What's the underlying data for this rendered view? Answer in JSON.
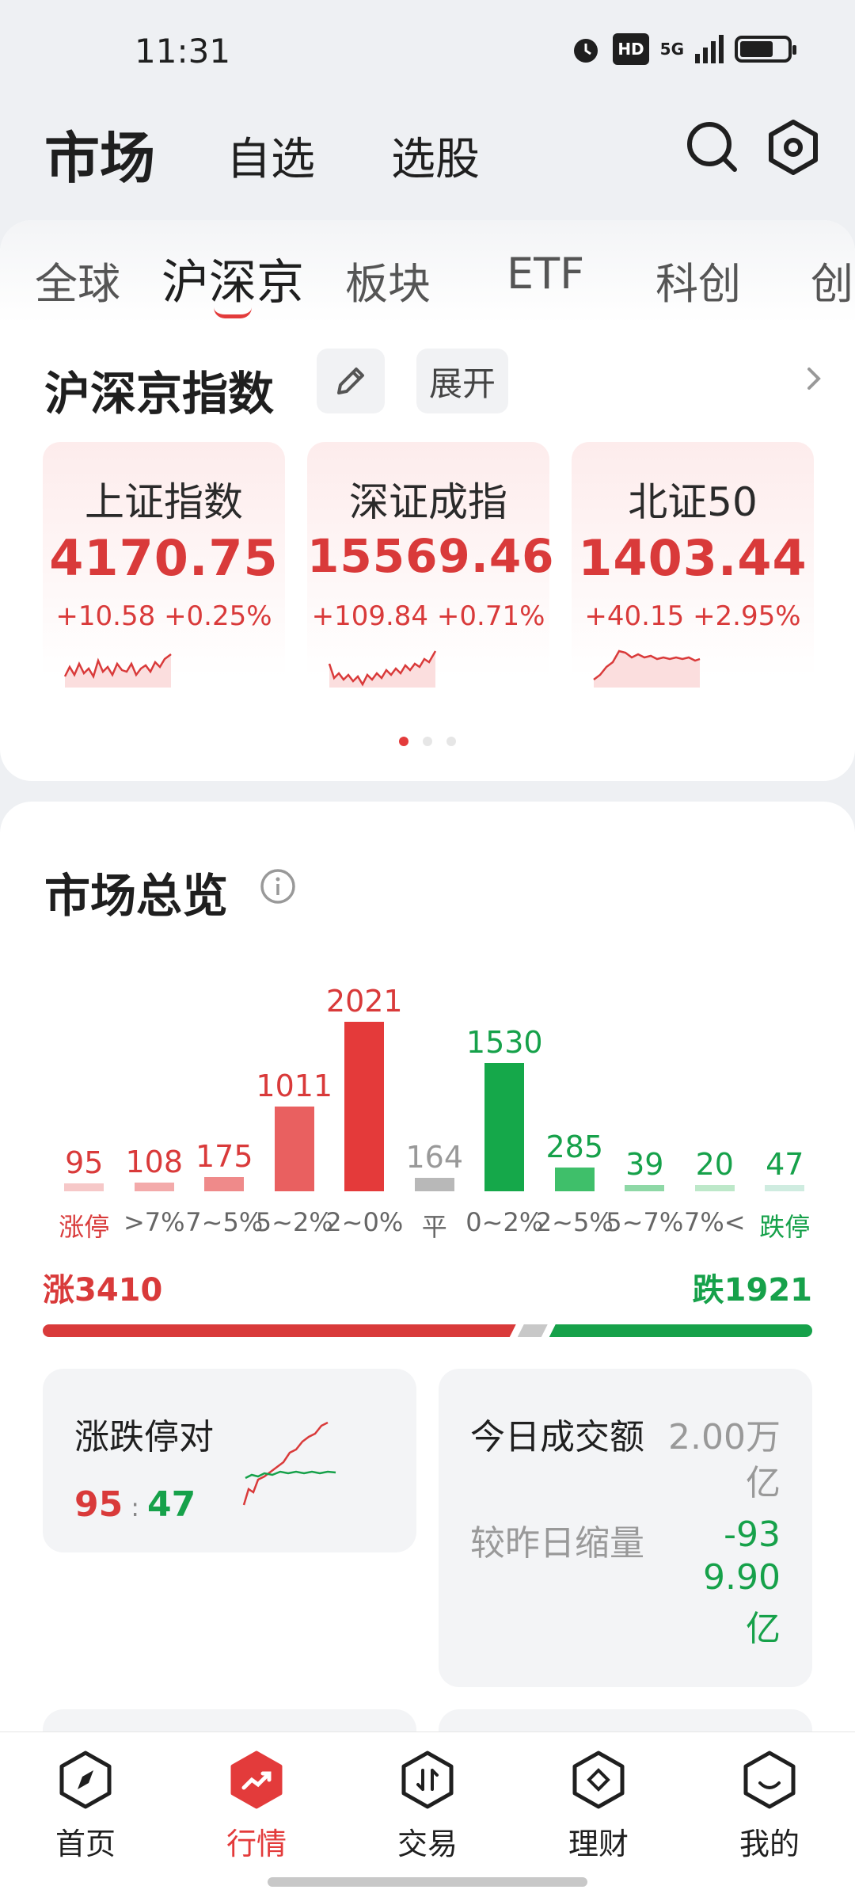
{
  "status_bar": {
    "time": "11:31",
    "hd": "HD",
    "network": "5G",
    "battery_level": 0.7
  },
  "header": {
    "tabs": [
      {
        "label": "市场",
        "active": true
      },
      {
        "label": "自选",
        "active": false
      },
      {
        "label": "选股",
        "active": false
      }
    ],
    "icons": [
      "search-icon",
      "settings-icon"
    ]
  },
  "subtabs": {
    "items": [
      {
        "label": "全球",
        "active": false
      },
      {
        "label": "沪深京",
        "active": true
      },
      {
        "label": "板块",
        "active": false
      },
      {
        "label": "ETF",
        "active": false
      },
      {
        "label": "科创",
        "active": false
      },
      {
        "label": "创",
        "active": false
      }
    ]
  },
  "indices_section": {
    "title": "沪深京指数",
    "expand_label": "展开",
    "cards": [
      {
        "name": "上证指数",
        "value": "4170.75",
        "change": "+10.58",
        "percent": "+0.25%"
      },
      {
        "name": "深证成指",
        "value": "15569.46",
        "change": "+109.84",
        "percent": "+0.71%"
      },
      {
        "name": "北证50",
        "value": "1403.44",
        "change": "+40.15",
        "percent": "+2.95%"
      }
    ],
    "page_count": 3,
    "active_page": 1
  },
  "overview": {
    "title": "市场总览",
    "chart_data": {
      "type": "bar",
      "categories": [
        "涨停",
        ">7%",
        "7~5%",
        "5~2%",
        "2~0%",
        "平",
        "0~2%",
        "2~5%",
        "5~7%",
        "7%<",
        "跌停"
      ],
      "values": [
        95,
        108,
        175,
        1011,
        2021,
        164,
        1530,
        285,
        39,
        20,
        47
      ],
      "bar_colors": [
        "#f6c8c8",
        "#f3aaaa",
        "#ef8a8a",
        "#e96060",
        "#e43a3a",
        "#b8b8b8",
        "#15a84a",
        "#3fbf6a",
        "#8ed8a6",
        "#bde8c9",
        "#cfece0"
      ],
      "label_colors": [
        "#d93a3a",
        "#d93a3a",
        "#d93a3a",
        "#d93a3a",
        "#d93a3a",
        "#999999",
        "#16a14a",
        "#16a14a",
        "#16a14a",
        "#16a14a",
        "#16a14a"
      ],
      "category_colors": [
        "#d93a3a",
        "#666666",
        "#666666",
        "#666666",
        "#666666",
        "#666666",
        "#666666",
        "#666666",
        "#666666",
        "#666666",
        "#16a14a"
      ],
      "ylim": [
        0,
        2100
      ]
    },
    "rise_total": "涨3410",
    "fall_total": "跌1921",
    "rise_count": 3410,
    "fall_count": 1921,
    "limit_tile": {
      "title": "涨跌停对",
      "up": "95",
      "sep": ":",
      "down": "47"
    },
    "turnover_tile": {
      "title": "今日成交额",
      "value_line1": "2.00万",
      "value_line2": "亿",
      "compare_label": "较昨日缩量",
      "compare_line1": "-93",
      "compare_line2": "9.90",
      "compare_line3": "亿"
    }
  },
  "bottom_nav": {
    "items": [
      {
        "label": "首页",
        "icon": "compass-icon",
        "active": false
      },
      {
        "label": "行情",
        "icon": "trend-icon",
        "active": true
      },
      {
        "label": "交易",
        "icon": "trade-icon",
        "active": false
      },
      {
        "label": "理财",
        "icon": "wealth-icon",
        "active": false
      },
      {
        "label": "我的",
        "icon": "profile-icon",
        "active": false
      }
    ]
  },
  "colors": {
    "accent": "#e33b3b",
    "up": "#d93a3a",
    "down": "#16a14a"
  }
}
